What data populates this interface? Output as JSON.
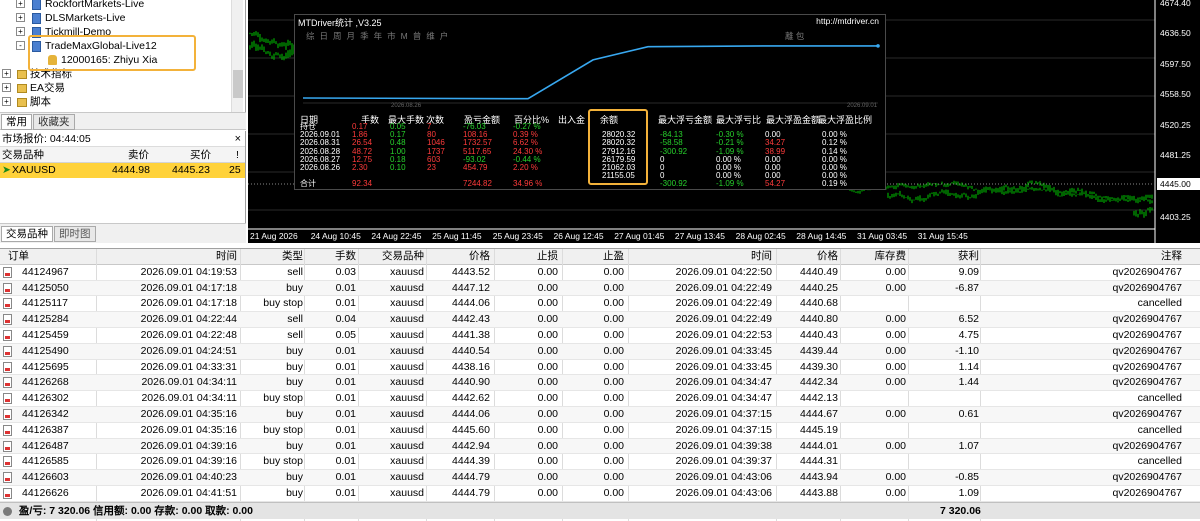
{
  "navigator": {
    "brokers": [
      {
        "label": "RockfortMarkets-Live",
        "expander": "+"
      },
      {
        "label": "DLSMarkets-Live",
        "expander": "+"
      },
      {
        "label": "Tickmill-Demo",
        "expander": "+"
      },
      {
        "label": "TradeMaxGlobal-Live12",
        "expander": "-"
      }
    ],
    "account": "12000165: Zhiyu Xia",
    "groups": [
      {
        "label": "技术指标",
        "expander": "+"
      },
      {
        "label": "EA交易",
        "expander": "+"
      },
      {
        "label": "脚本",
        "expander": "+"
      }
    ],
    "tabs": [
      "常用",
      "收藏夹"
    ]
  },
  "market_watch": {
    "title": "市场报价: 04:44:05",
    "close": "×",
    "headers": {
      "symbol": "交易品种",
      "bid": "卖价",
      "ask": "买价",
      "spread": "!"
    },
    "row": {
      "symbol": "XAUUSD",
      "bid": "4444.98",
      "ask": "4445.23",
      "spread": "25"
    },
    "tabs": [
      "交易品种",
      "即时图"
    ]
  },
  "chart": {
    "price_labels": [
      "4674.40",
      "4636.50",
      "4597.50",
      "4558.50",
      "4520.25",
      "4481.25",
      "4445.00",
      "4403.25"
    ],
    "current_price": "4445.00",
    "time_labels": [
      "21 Aug 2026",
      "24 Aug 10:45",
      "24 Aug 22:45",
      "25 Aug 11:45",
      "25 Aug 23:45",
      "26 Aug 12:45",
      "27 Aug 01:45",
      "27 Aug 13:45",
      "28 Aug 02:45",
      "28 Aug 14:45",
      "31 Aug 03:45",
      "31 Aug 15:45"
    ],
    "colors": {
      "bg": "#000000",
      "candles": "#00c800",
      "grid": "#2a2a2a"
    }
  },
  "overlay": {
    "title": "MTDriver统计 ,V3.25",
    "link": "http://mtdriver.cn",
    "menu": [
      "综",
      "日",
      "周",
      "月",
      "季",
      "年",
      "市",
      "M",
      "曾",
      "维",
      "户"
    ],
    "menu_right": "離 包",
    "mini_axis": [
      "2026.08.26",
      "2026.09.01"
    ],
    "headers": [
      "日期",
      "手数",
      "最大手数",
      "次数",
      "盈亏金额",
      "百分比%",
      "出入金",
      "余额",
      "最大浮亏金额",
      "最大浮亏比",
      "最大浮盈金额",
      "最大浮盈比例"
    ],
    "rows": [
      {
        "date": "持仓",
        "lots": "0.17",
        "max_lots": "0.05",
        "count": "7",
        "pnl": "-76.03",
        "pct": "-0.27 %",
        "balance": "",
        "max_float_loss": "",
        "max_float_loss_pct": "",
        "max_float_profit": "",
        "max_float_profit_pct": ""
      },
      {
        "date": "2026.09.01",
        "lots": "1.86",
        "max_lots": "0.17",
        "count": "80",
        "pnl": "108.16",
        "pct": "0.39 %",
        "balance": "28020.32",
        "max_float_loss": "-84.13",
        "max_float_loss_pct": "-0.30 %",
        "max_float_profit": "0.00",
        "max_float_profit_pct": "0.00 %"
      },
      {
        "date": "2026.08.31",
        "lots": "26.54",
        "max_lots": "0.48",
        "count": "1046",
        "pnl": "1732.57",
        "pct": "6.62 %",
        "balance": "28020.32",
        "max_float_loss": "-58.58",
        "max_float_loss_pct": "-0.21 %",
        "max_float_profit": "34.27",
        "max_float_profit_pct": "0.12 %"
      },
      {
        "date": "2026.08.28",
        "lots": "48.72",
        "max_lots": "1.00",
        "count": "1737",
        "pnl": "5117.65",
        "pct": "24.30 %",
        "balance": "27912.16",
        "max_float_loss": "-300.92",
        "max_float_loss_pct": "-1.09 %",
        "max_float_profit": "38.99",
        "max_float_profit_pct": "0.14 %"
      },
      {
        "date": "2026.08.27",
        "lots": "12.75",
        "max_lots": "0.18",
        "count": "603",
        "pnl": "-93.02",
        "pct": "-0.44 %",
        "balance": "26179.59",
        "max_float_loss": "0",
        "max_float_loss_pct": "0.00 %",
        "max_float_profit": "0.00",
        "max_float_profit_pct": "0.00 %"
      },
      {
        "date": "2026.08.26",
        "lots": "2.30",
        "max_lots": "0.10",
        "count": "23",
        "pnl": "454.79",
        "pct": "2.20 %",
        "balance": "21062.03",
        "max_float_loss": "0",
        "max_float_loss_pct": "0.00 %",
        "max_float_profit": "0.00",
        "max_float_profit_pct": "0.00 %"
      },
      {
        "date": "",
        "lots": "",
        "max_lots": "",
        "count": "",
        "pnl": "",
        "pct": "",
        "balance": "21155.05",
        "max_float_loss": "0",
        "max_float_loss_pct": "0.00 %",
        "max_float_profit": "0.00",
        "max_float_profit_pct": "0.00 %"
      },
      {
        "date": "合计",
        "lots": "92.34",
        "max_lots": "",
        "count": "",
        "pnl": "7244.82",
        "pct": "34.96 %",
        "balance": "",
        "max_float_loss": "-300.92",
        "max_float_loss_pct": "-1.09 %",
        "max_float_profit": "54.27",
        "max_float_profit_pct": "0.19 %"
      }
    ]
  },
  "history": {
    "headers": {
      "order": "订单",
      "open_time": "时间",
      "sort": "/",
      "type": "类型",
      "lots": "手数",
      "symbol": "交易品种",
      "open_price": "价格",
      "sl": "止损",
      "tp": "止盈",
      "close_time": "时间",
      "close_price": "价格",
      "swap": "库存费",
      "profit": "获利",
      "comment": "注释"
    },
    "rows": [
      {
        "order": "44124967",
        "open_time": "2026.09.01 04:19:53",
        "type": "sell",
        "lots": "0.03",
        "symbol": "xauusd",
        "open_price": "4443.52",
        "sl": "0.00",
        "tp": "0.00",
        "close_time": "2026.09.01 04:22:50",
        "close_price": "4440.49",
        "swap": "0.00",
        "profit": "9.09",
        "comment": "qv2026904767"
      },
      {
        "order": "44125050",
        "open_time": "2026.09.01 04:17:18",
        "type": "buy",
        "lots": "0.01",
        "symbol": "xauusd",
        "open_price": "4447.12",
        "sl": "0.00",
        "tp": "0.00",
        "close_time": "2026.09.01 04:22:49",
        "close_price": "4440.25",
        "swap": "0.00",
        "profit": "-6.87",
        "comment": "qv2026904767"
      },
      {
        "order": "44125117",
        "open_time": "2026.09.01 04:17:18",
        "type": "buy stop",
        "lots": "0.01",
        "symbol": "xauusd",
        "open_price": "4444.06",
        "sl": "0.00",
        "tp": "0.00",
        "close_time": "2026.09.01 04:22:49",
        "close_price": "4440.68",
        "swap": "",
        "profit": "",
        "comment": "cancelled"
      },
      {
        "order": "44125284",
        "open_time": "2026.09.01 04:22:44",
        "type": "sell",
        "lots": "0.04",
        "symbol": "xauusd",
        "open_price": "4442.43",
        "sl": "0.00",
        "tp": "0.00",
        "close_time": "2026.09.01 04:22:49",
        "close_price": "4440.80",
        "swap": "0.00",
        "profit": "6.52",
        "comment": "qv2026904767"
      },
      {
        "order": "44125459",
        "open_time": "2026.09.01 04:22:48",
        "type": "sell",
        "lots": "0.05",
        "symbol": "xauusd",
        "open_price": "4441.38",
        "sl": "0.00",
        "tp": "0.00",
        "close_time": "2026.09.01 04:22:53",
        "close_price": "4440.43",
        "swap": "0.00",
        "profit": "4.75",
        "comment": "qv2026904767"
      },
      {
        "order": "44125490",
        "open_time": "2026.09.01 04:24:51",
        "type": "buy",
        "lots": "0.01",
        "symbol": "xauusd",
        "open_price": "4440.54",
        "sl": "0.00",
        "tp": "0.00",
        "close_time": "2026.09.01 04:33:45",
        "close_price": "4439.44",
        "swap": "0.00",
        "profit": "-1.10",
        "comment": "qv2026904767"
      },
      {
        "order": "44125695",
        "open_time": "2026.09.01 04:33:31",
        "type": "buy",
        "lots": "0.01",
        "symbol": "xauusd",
        "open_price": "4438.16",
        "sl": "0.00",
        "tp": "0.00",
        "close_time": "2026.09.01 04:33:45",
        "close_price": "4439.30",
        "swap": "0.00",
        "profit": "1.14",
        "comment": "qv2026904767"
      },
      {
        "order": "44126268",
        "open_time": "2026.09.01 04:34:11",
        "type": "buy",
        "lots": "0.01",
        "symbol": "xauusd",
        "open_price": "4440.90",
        "sl": "0.00",
        "tp": "0.00",
        "close_time": "2026.09.01 04:34:47",
        "close_price": "4442.34",
        "swap": "0.00",
        "profit": "1.44",
        "comment": "qv2026904767"
      },
      {
        "order": "44126302",
        "open_time": "2026.09.01 04:34:11",
        "type": "buy stop",
        "lots": "0.01",
        "symbol": "xauusd",
        "open_price": "4442.62",
        "sl": "0.00",
        "tp": "0.00",
        "close_time": "2026.09.01 04:34:47",
        "close_price": "4442.13",
        "swap": "",
        "profit": "",
        "comment": "cancelled"
      },
      {
        "order": "44126342",
        "open_time": "2026.09.01 04:35:16",
        "type": "buy",
        "lots": "0.01",
        "symbol": "xauusd",
        "open_price": "4444.06",
        "sl": "0.00",
        "tp": "0.00",
        "close_time": "2026.09.01 04:37:15",
        "close_price": "4444.67",
        "swap": "0.00",
        "profit": "0.61",
        "comment": "qv2026904767"
      },
      {
        "order": "44126387",
        "open_time": "2026.09.01 04:35:16",
        "type": "buy stop",
        "lots": "0.01",
        "symbol": "xauusd",
        "open_price": "4445.60",
        "sl": "0.00",
        "tp": "0.00",
        "close_time": "2026.09.01 04:37:15",
        "close_price": "4445.19",
        "swap": "",
        "profit": "",
        "comment": "cancelled"
      },
      {
        "order": "44126487",
        "open_time": "2026.09.01 04:39:16",
        "type": "buy",
        "lots": "0.01",
        "symbol": "xauusd",
        "open_price": "4442.94",
        "sl": "0.00",
        "tp": "0.00",
        "close_time": "2026.09.01 04:39:38",
        "close_price": "4444.01",
        "swap": "0.00",
        "profit": "1.07",
        "comment": "qv2026904767"
      },
      {
        "order": "44126585",
        "open_time": "2026.09.01 04:39:16",
        "type": "buy stop",
        "lots": "0.01",
        "symbol": "xauusd",
        "open_price": "4444.39",
        "sl": "0.00",
        "tp": "0.00",
        "close_time": "2026.09.01 04:39:37",
        "close_price": "4444.31",
        "swap": "",
        "profit": "",
        "comment": "cancelled"
      },
      {
        "order": "44126603",
        "open_time": "2026.09.01 04:40:23",
        "type": "buy",
        "lots": "0.01",
        "symbol": "xauusd",
        "open_price": "4444.79",
        "sl": "0.00",
        "tp": "0.00",
        "close_time": "2026.09.01 04:43:06",
        "close_price": "4443.94",
        "swap": "0.00",
        "profit": "-0.85",
        "comment": "qv2026904767"
      },
      {
        "order": "44126626",
        "open_time": "2026.09.01 04:41:51",
        "type": "buy",
        "lots": "0.01",
        "symbol": "xauusd",
        "open_price": "4444.79",
        "sl": "0.00",
        "tp": "0.00",
        "close_time": "2026.09.01 04:43:06",
        "close_price": "4443.88",
        "swap": "0.00",
        "profit": "1.09",
        "comment": "qv2026904767"
      }
    ],
    "footer": {
      "summary": "盈/亏: 7 320.06  信用额: 0.00  存款: 0.00  取款: 0.00",
      "total": "7 320.06"
    }
  }
}
